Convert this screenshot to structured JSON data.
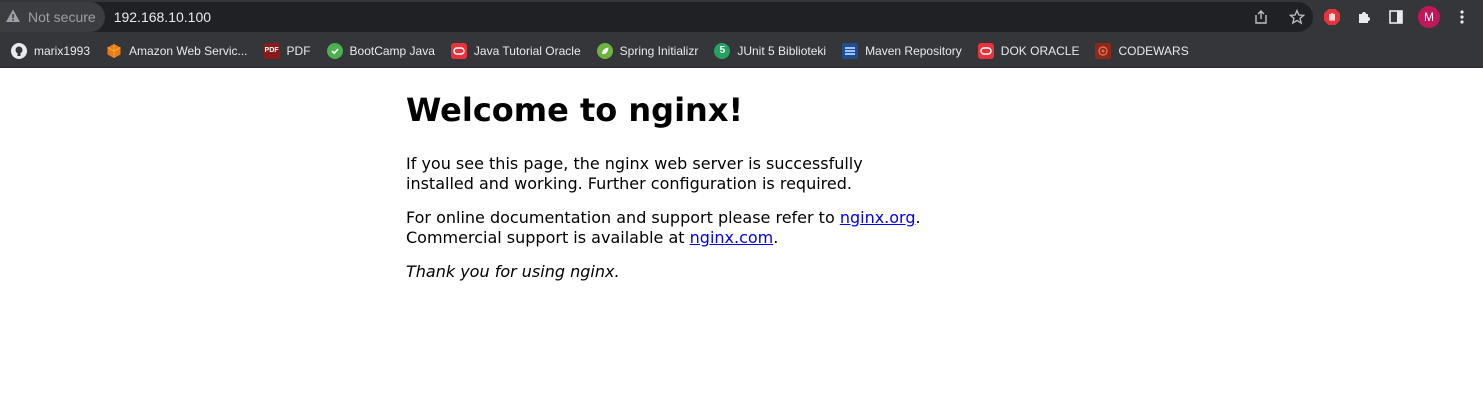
{
  "browser": {
    "security_label": "Not secure",
    "url": "192.168.10.100",
    "profile_initial": "M",
    "icons": [
      "warning-icon",
      "share-icon",
      "star-icon",
      "extension-shield-icon",
      "puzzle-icon",
      "sidepanel-icon",
      "menu-dots-icon"
    ]
  },
  "bookmarks": [
    {
      "label": "marix1993",
      "icon": "github-icon"
    },
    {
      "label": "Amazon Web Servic...",
      "icon": "aws-icon"
    },
    {
      "label": "PDF",
      "icon": "pdf-icon"
    },
    {
      "label": "BootCamp Java",
      "icon": "bootcamp-icon"
    },
    {
      "label": "Java Tutorial Oracle",
      "icon": "oracle-icon"
    },
    {
      "label": "Spring Initializr",
      "icon": "spring-icon"
    },
    {
      "label": "JUnit 5 Biblioteki",
      "icon": "junit-icon"
    },
    {
      "label": "Maven Repository",
      "icon": "maven-icon"
    },
    {
      "label": "DOK ORACLE",
      "icon": "oracle-icon"
    },
    {
      "label": "CODEWARS",
      "icon": "codewars-icon"
    }
  ],
  "page": {
    "title": "Welcome to nginx!",
    "p1": "If you see this page, the nginx web server is successfully installed and working. Further configuration is required.",
    "p2_prefix": "For online documentation and support please refer to ",
    "link1": "nginx.org",
    "p2_mid": ".",
    "p2_line2_prefix": "Commercial support is available at ",
    "link2": "nginx.com",
    "p2_suffix": ".",
    "thanks": "Thank you for using nginx."
  }
}
